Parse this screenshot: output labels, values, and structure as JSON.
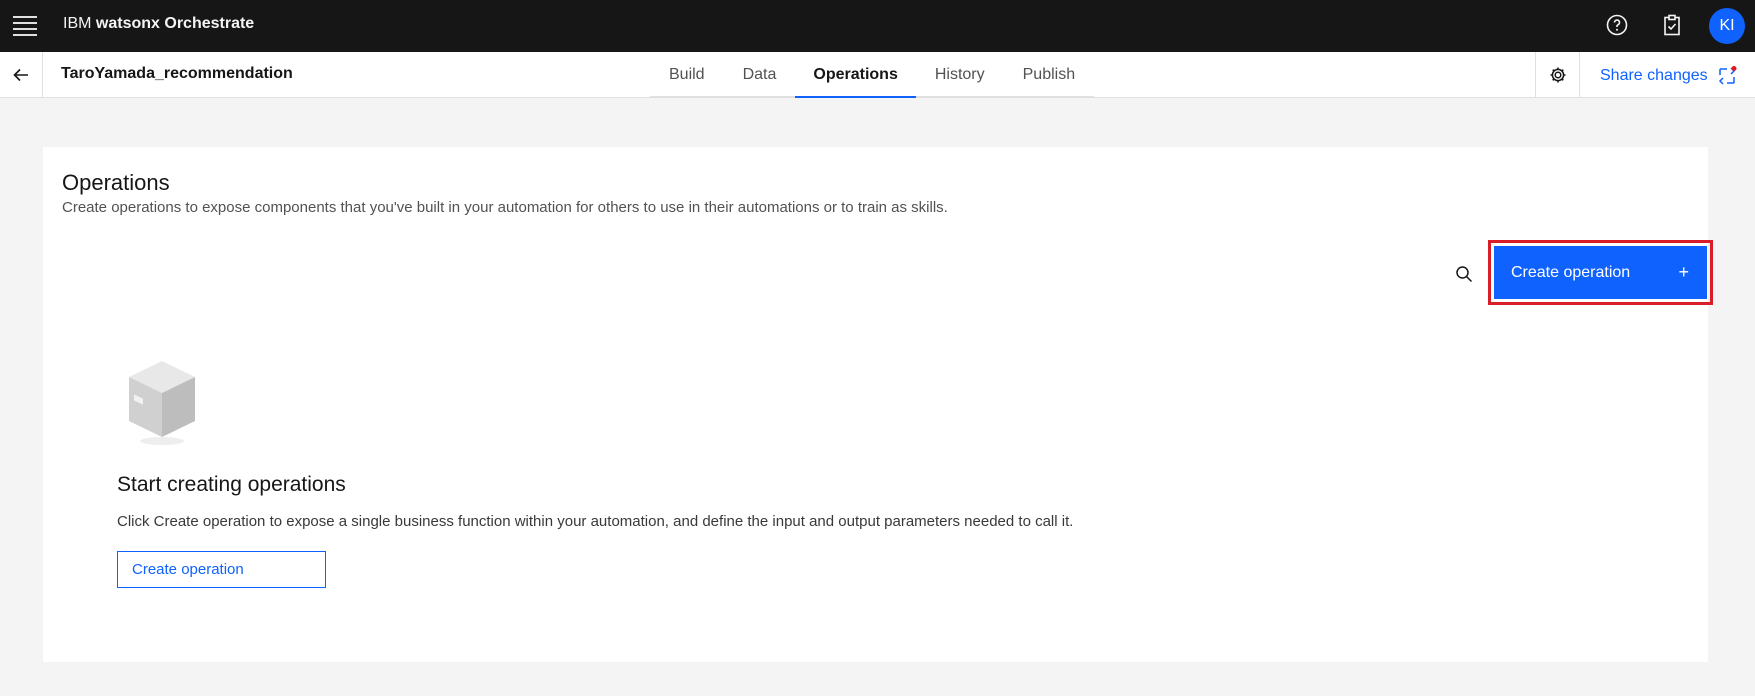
{
  "header": {
    "brand_prefix": "IBM",
    "brand_name": "watsonx Orchestrate",
    "avatar_initials": "KI"
  },
  "subheader": {
    "project_title": "TaroYamada_recommendation",
    "tabs": [
      {
        "label": "Build",
        "active": false
      },
      {
        "label": "Data",
        "active": false
      },
      {
        "label": "Operations",
        "active": true
      },
      {
        "label": "History",
        "active": false
      },
      {
        "label": "Publish",
        "active": false
      }
    ],
    "share_label": "Share changes"
  },
  "main": {
    "title": "Operations",
    "description": "Create operations to expose components that you've built in your automation for others to use in their automations or to train as skills.",
    "primary_button_label": "Create operation",
    "empty_state": {
      "title": "Start creating operations",
      "description": "Click Create operation to expose a single business function within your automation, and define the input and output parameters needed to call it.",
      "button_label": "Create operation"
    }
  },
  "colors": {
    "accent": "#0f62fe",
    "header_bg": "#161616",
    "highlight": "#da1e28"
  }
}
